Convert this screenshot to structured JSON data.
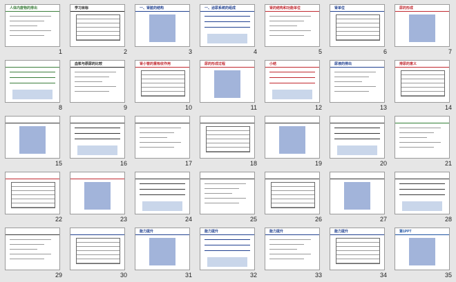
{
  "slides": [
    {
      "num": "1",
      "title": "人体内废物的排出",
      "bg": "#ffffff",
      "accent": "#3a7d3a"
    },
    {
      "num": "2",
      "title": "学习目标",
      "bg": "#ffffff",
      "accent": "#222222"
    },
    {
      "num": "3",
      "title": "一、肾脏的结构",
      "bg": "#ffffff",
      "accent": "#1f3f8f"
    },
    {
      "num": "4",
      "title": "一、泌尿系统的组成",
      "bg": "#ffffff",
      "accent": "#1f3f8f"
    },
    {
      "num": "5",
      "title": "肾的结构和功能单位",
      "bg": "#ffffff",
      "accent": "#c0262d"
    },
    {
      "num": "6",
      "title": "肾单位",
      "bg": "#ffffff",
      "accent": "#1f3f8f"
    },
    {
      "num": "7",
      "title": "尿的形成",
      "bg": "#ffffff",
      "accent": "#c0262d"
    },
    {
      "num": "8",
      "title": "",
      "bg": "#ffffff",
      "accent": "#3a7d3a"
    },
    {
      "num": "9",
      "title": "血浆与原尿的比较",
      "bg": "#ffffff",
      "accent": "#222222"
    },
    {
      "num": "10",
      "title": "肾小管的重吸收作用",
      "bg": "#ffffff",
      "accent": "#c0262d"
    },
    {
      "num": "11",
      "title": "尿的形成过程",
      "bg": "#ffffff",
      "accent": "#c0262d"
    },
    {
      "num": "12",
      "title": "小结",
      "bg": "#ffffff",
      "accent": "#c0262d"
    },
    {
      "num": "13",
      "title": "尿液的排出",
      "bg": "#ffffff",
      "accent": "#1f3f8f"
    },
    {
      "num": "14",
      "title": "排尿的意义",
      "bg": "#ffffff",
      "accent": "#c0262d"
    },
    {
      "num": "15",
      "title": "",
      "bg": "#ffffff",
      "accent": "#333333"
    },
    {
      "num": "16",
      "title": "",
      "bg": "#ffffff",
      "accent": "#333333"
    },
    {
      "num": "17",
      "title": "",
      "bg": "#ffffff",
      "accent": "#333333"
    },
    {
      "num": "18",
      "title": "",
      "bg": "#ffffff",
      "accent": "#333333"
    },
    {
      "num": "19",
      "title": "",
      "bg": "#ffffff",
      "accent": "#333333"
    },
    {
      "num": "20",
      "title": "",
      "bg": "#ffffff",
      "accent": "#333333"
    },
    {
      "num": "21",
      "title": "",
      "bg": "#ffffff",
      "accent": "#2e7d32"
    },
    {
      "num": "22",
      "title": "",
      "bg": "#ffffff",
      "accent": "#c0262d"
    },
    {
      "num": "23",
      "title": "",
      "bg": "#ffffff",
      "accent": "#c0262d"
    },
    {
      "num": "24",
      "title": "",
      "bg": "#ffffff",
      "accent": "#333333"
    },
    {
      "num": "25",
      "title": "",
      "bg": "#ffffff",
      "accent": "#333333"
    },
    {
      "num": "26",
      "title": "",
      "bg": "#ffffff",
      "accent": "#333333"
    },
    {
      "num": "27",
      "title": "",
      "bg": "#ffffff",
      "accent": "#333333"
    },
    {
      "num": "28",
      "title": "",
      "bg": "#ffffff",
      "accent": "#333333"
    },
    {
      "num": "29",
      "title": "",
      "bg": "#ffffff",
      "accent": "#333333"
    },
    {
      "num": "30",
      "title": "",
      "bg": "#ffffff",
      "accent": "#1f3f8f"
    },
    {
      "num": "31",
      "title": "能力提升",
      "bg": "#ffffff",
      "accent": "#1f3f8f"
    },
    {
      "num": "32",
      "title": "能力提升",
      "bg": "#ffffff",
      "accent": "#1f3f8f"
    },
    {
      "num": "33",
      "title": "能力提升",
      "bg": "#ffffff",
      "accent": "#1f3f8f"
    },
    {
      "num": "34",
      "title": "能力提升",
      "bg": "#ffffff",
      "accent": "#1f3f8f"
    },
    {
      "num": "35",
      "title": "第1PPT",
      "bg": "#ffffff",
      "accent": "#1a4fa0"
    }
  ]
}
